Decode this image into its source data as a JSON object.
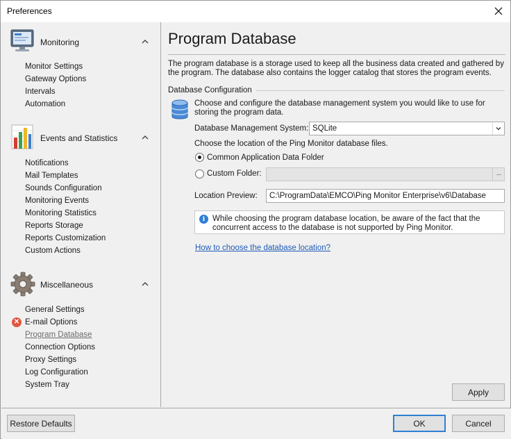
{
  "window": {
    "title": "Preferences"
  },
  "sidebar": {
    "categories": [
      {
        "label": "Monitoring",
        "items": [
          "Monitor Settings",
          "Gateway Options",
          "Intervals",
          "Automation"
        ]
      },
      {
        "label": "Events and Statistics",
        "items": [
          "Notifications",
          "Mail Templates",
          "Sounds Configuration",
          "Monitoring Events",
          "Monitoring Statistics",
          "Reports Storage",
          "Reports Customization",
          "Custom Actions"
        ]
      },
      {
        "label": "Miscellaneous",
        "items": [
          "General Settings",
          "E-mail Options",
          "Program Database",
          "Connection Options",
          "Proxy Settings",
          "Log Configuration",
          "System Tray"
        ]
      }
    ]
  },
  "main": {
    "title": "Program Database",
    "description": "The program database is a storage used to keep all the business data created and gathered by the program. The database also contains the logger catalog that stores the program events.",
    "group_label": "Database Configuration",
    "config_intro": "Choose and configure the database management system you would like to use for storing the program data.",
    "dbms_label": "Database Management System:",
    "dbms_value": "SQLite",
    "location_prompt": "Choose the location of the Ping Monitor database files.",
    "radio_common": "Common Application Data Folder",
    "radio_custom": "Custom Folder:",
    "custom_folder_value": "",
    "browse_label": "···",
    "preview_label": "Location Preview:",
    "preview_value": "C:\\ProgramData\\EMCO\\Ping Monitor Enterprise\\v6\\Database",
    "info_text": "While choosing the program database location, be aware of the fact that the concurrent access to the database is not supported by Ping Monitor.",
    "help_link": "How to choose the database location?"
  },
  "buttons": {
    "apply": "Apply",
    "restore_defaults": "Restore Defaults",
    "ok": "OK",
    "cancel": "Cancel"
  },
  "colors": {
    "link": "#1f5cb8",
    "error": "#e0553f",
    "info": "#2f7fd4"
  },
  "icons": {
    "monitoring": "monitor-icon",
    "events": "bar-chart-icon",
    "misc": "gear-icon",
    "database": "database-icon",
    "error": "error-icon",
    "info": "info-icon"
  }
}
